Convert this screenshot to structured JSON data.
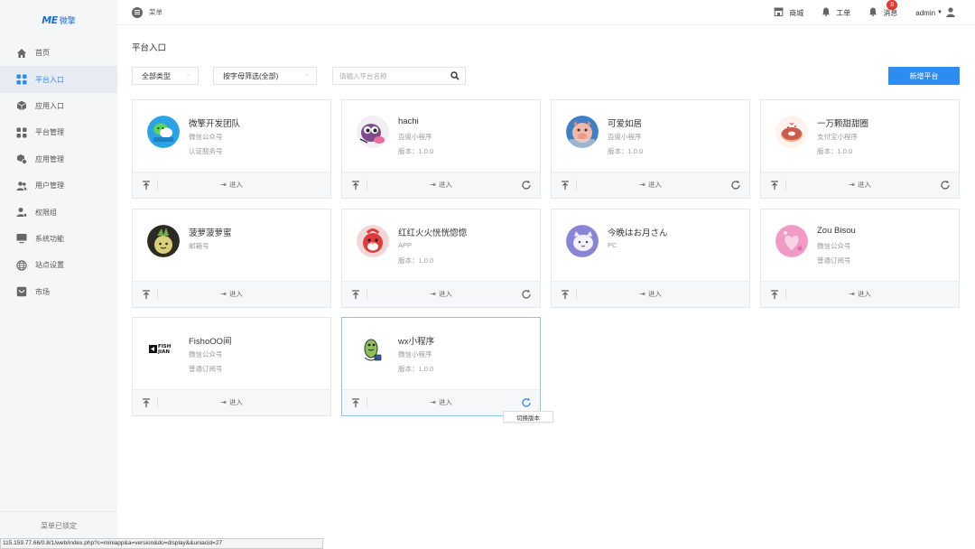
{
  "brand": {
    "mark": "ME",
    "name": "微擎"
  },
  "header": {
    "menu_label": "菜单",
    "items": [
      {
        "label": "商城",
        "icon": "shop-icon"
      },
      {
        "label": "工单",
        "icon": "bell-icon"
      },
      {
        "label": "消息",
        "icon": "bell-icon",
        "badge": "8"
      }
    ],
    "user": "admin"
  },
  "sidebar": {
    "items": [
      {
        "label": "首页",
        "icon": "home-icon"
      },
      {
        "label": "平台入口",
        "icon": "grid-icon",
        "active": true
      },
      {
        "label": "应用入口",
        "icon": "cube-icon"
      },
      {
        "label": "平台管理",
        "icon": "grid-icon"
      },
      {
        "label": "应用管理",
        "icon": "apps-gear-icon"
      },
      {
        "label": "用户管理",
        "icon": "users-icon"
      },
      {
        "label": "权限组",
        "icon": "user-key-icon"
      },
      {
        "label": "系统功能",
        "icon": "monitor-icon"
      },
      {
        "label": "站点设置",
        "icon": "globe-icon"
      },
      {
        "label": "市场",
        "icon": "market-icon"
      }
    ],
    "lock_label": "菜单已锁定"
  },
  "page": {
    "title": "平台入口",
    "filter_type": "全部类型",
    "filter_letter": "按字母筛选(全部)",
    "search_placeholder": "请输入平台名称",
    "add_button": "新增平台"
  },
  "cards": [
    {
      "name": "微擎开发团队",
      "line1": "微信公众号",
      "line2": "认证服务号",
      "avatar": "wechat-team",
      "refresh": false
    },
    {
      "name": "hachi",
      "line1": "百度小程序",
      "line2": "版本：1.0.0",
      "avatar": "purple-toy",
      "refresh": true
    },
    {
      "name": "可爱如居",
      "line1": "百度小程序",
      "line2": "版本：1.0.0",
      "avatar": "pig",
      "refresh": true
    },
    {
      "name": "一万颗甜甜圈",
      "line1": "支付宝小程序",
      "line2": "版本：1.0.0",
      "avatar": "donut",
      "refresh": true
    },
    {
      "name": "菠萝菠萝蜜",
      "line1": "邮箱号",
      "line2": "",
      "avatar": "pineapple",
      "refresh": false
    },
    {
      "name": "红红火火恍恍惚惚",
      "line1": "APP",
      "line2": "版本：1.0.0",
      "avatar": "red-bird",
      "refresh": true
    },
    {
      "name": "今晚はお月さん",
      "line1": "PC",
      "line2": "",
      "avatar": "moon-cat",
      "refresh": false
    },
    {
      "name": "Zou Bisou",
      "line1": "微信公众号",
      "line2": "普通订阅号",
      "avatar": "pink-heart",
      "refresh": false
    },
    {
      "name": "FishoOO间",
      "line1": "微信公众号",
      "line2": "普通订阅号",
      "avatar": "fish-logo",
      "refresh": false
    },
    {
      "name": "wx小程序",
      "line1": "微信小程序",
      "line2": "版本：1.0.0",
      "avatar": "green-monster",
      "refresh": true,
      "hover": true
    }
  ],
  "enter_label": "进入",
  "fish_logo_text": "FISH JIAN",
  "tooltip": "切换版本",
  "status_url": "115.159.77.66/0.8/1/web/index.php?c=miniapp&a=version&do=display&&uniacid=27",
  "colors": {
    "accent": "#2d8cf0",
    "badge": "#e8352e",
    "sidebar_bg": "#f4f6f8"
  }
}
